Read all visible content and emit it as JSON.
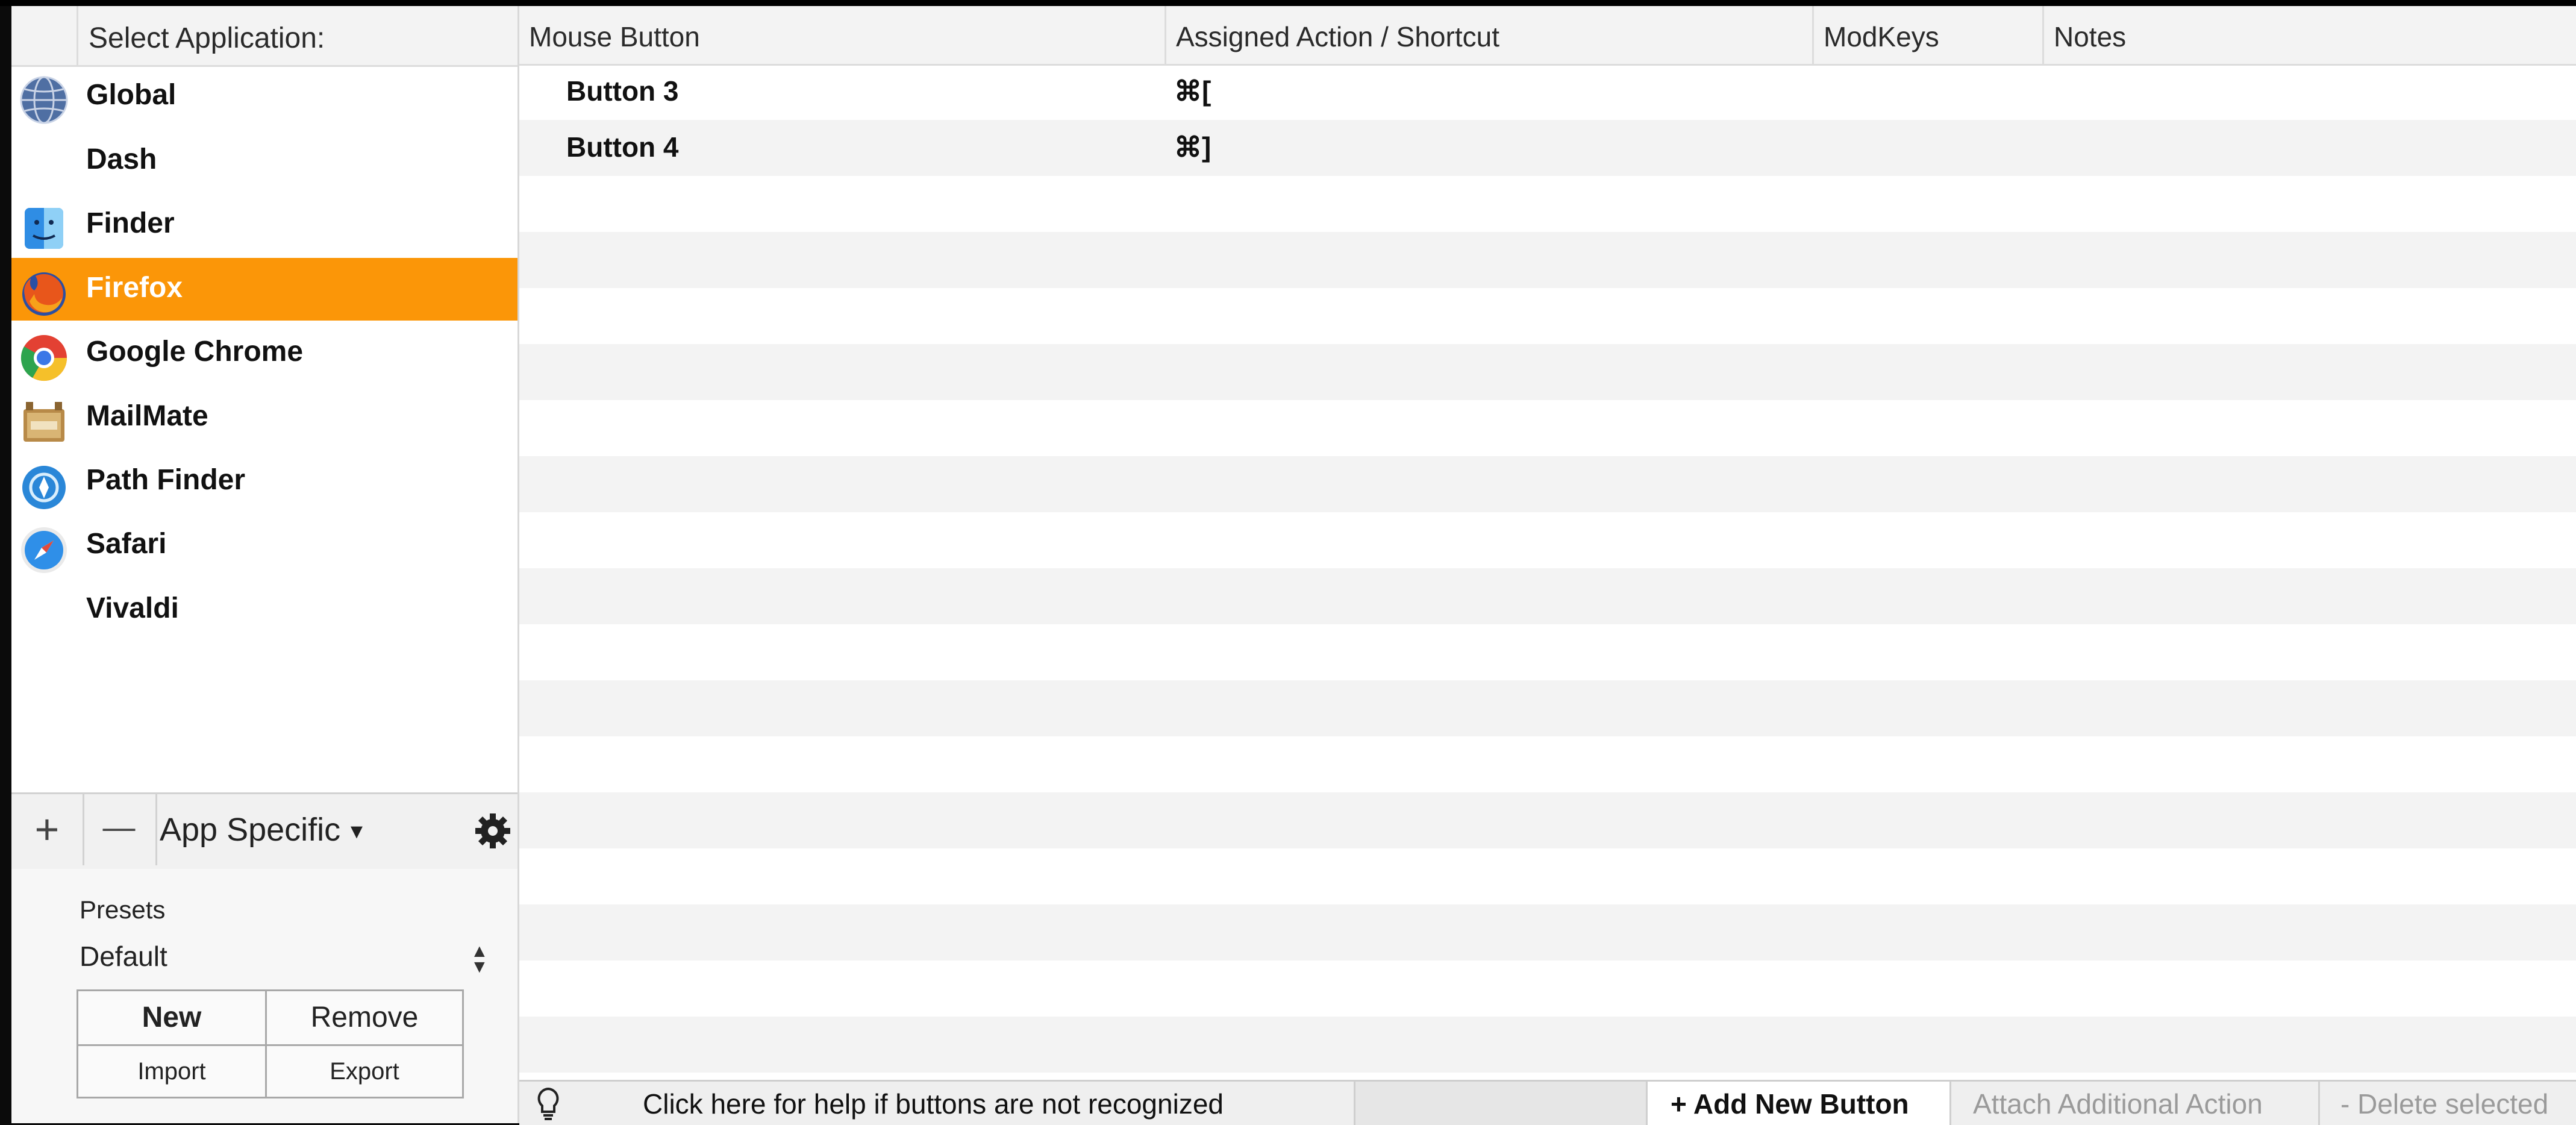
{
  "sidebar": {
    "header": "Select Application:",
    "apps": [
      {
        "label": "Global",
        "icon": "globe-icon"
      },
      {
        "label": "Dash",
        "icon": ""
      },
      {
        "label": "Finder",
        "icon": "finder-icon"
      },
      {
        "label": "Firefox",
        "icon": "firefox-icon",
        "selected": true
      },
      {
        "label": "Google Chrome",
        "icon": "chrome-icon"
      },
      {
        "label": "MailMate",
        "icon": "mailmate-icon"
      },
      {
        "label": "Path Finder",
        "icon": "path-finder-icon"
      },
      {
        "label": "Safari",
        "icon": "safari-icon"
      },
      {
        "label": "Vivaldi",
        "icon": ""
      }
    ],
    "toolbar": {
      "add_glyph": "+",
      "remove_glyph": "—",
      "mode_label": "App Specific",
      "mode_caret": "▼"
    },
    "presets": {
      "label": "Presets",
      "selected": "Default",
      "new_label": "New",
      "remove_label": "Remove",
      "import_label": "Import",
      "export_label": "Export"
    }
  },
  "table": {
    "columns": [
      "Mouse Button",
      "Assigned Action / Shortcut",
      "ModKeys",
      "Notes"
    ],
    "rows": [
      {
        "button": "Button 3",
        "action": "⌘[",
        "modkeys": "",
        "notes": ""
      },
      {
        "button": "Button 4",
        "action": "⌘]",
        "modkeys": "",
        "notes": ""
      }
    ]
  },
  "bottom_bar": {
    "help_text": "Click here for help if buttons are not recognized",
    "add_button": "+ Add New Button",
    "attach_action": "Attach Additional Action",
    "delete_selected": "- Delete selected"
  },
  "colors": {
    "selection": "#fb9608",
    "row_alt": "#f3f3f3",
    "disabled_text": "#9a9a9a"
  }
}
